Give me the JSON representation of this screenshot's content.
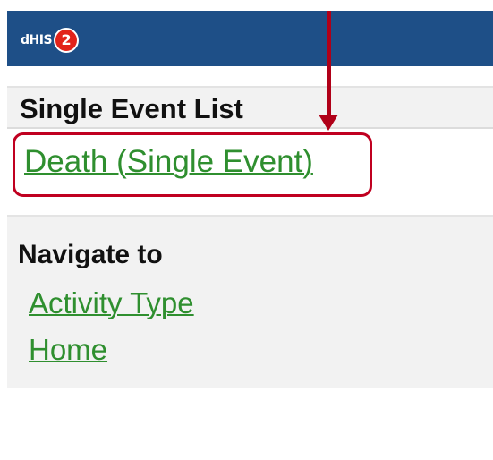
{
  "header": {
    "logo_text": "dHIS",
    "logo_badge": "2",
    "brand_color": "#1e4f87"
  },
  "list": {
    "title": "Single Event List",
    "items": [
      {
        "label": "Death (Single Event)"
      }
    ]
  },
  "navigation": {
    "title": "Navigate to",
    "links": [
      {
        "label": "Activity Type"
      },
      {
        "label": "Home"
      }
    ]
  },
  "annotation": {
    "color": "#b00018"
  }
}
